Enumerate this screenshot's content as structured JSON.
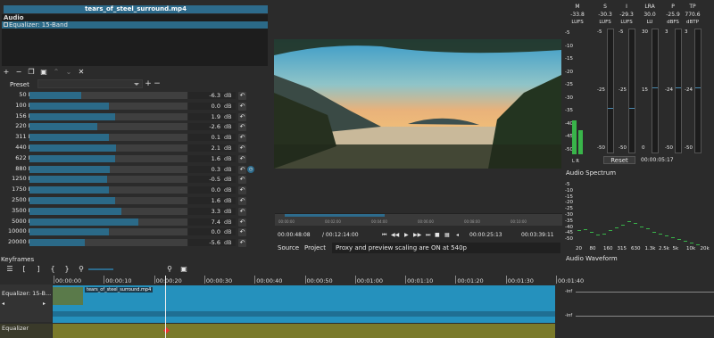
{
  "filter_panel": {
    "title": "tears_of_steel_surround.mp4",
    "group": "Audio",
    "item": "Equalizer: 15-Band",
    "preset_label": "Preset"
  },
  "bands": [
    {
      "label": "50 Hz",
      "value": "-6.3",
      "frac": 0.33
    },
    {
      "label": "100 Hz",
      "value": "0.0",
      "frac": 0.5
    },
    {
      "label": "156 Hz",
      "value": "1.9",
      "frac": 0.54
    },
    {
      "label": "220 Hz",
      "value": "-2.6",
      "frac": 0.43
    },
    {
      "label": "311 Hz",
      "value": "0.1",
      "frac": 0.5
    },
    {
      "label": "440 Hz",
      "value": "2.1",
      "frac": 0.55
    },
    {
      "label": "622 Hz",
      "value": "1.6",
      "frac": 0.54
    },
    {
      "label": "880 Hz",
      "value": "0.3",
      "frac": 0.51
    },
    {
      "label": "1250 Hz",
      "value": "-0.5",
      "frac": 0.49
    },
    {
      "label": "1750 Hz",
      "value": "0.0",
      "frac": 0.5
    },
    {
      "label": "2500 Hz",
      "value": "1.6",
      "frac": 0.54
    },
    {
      "label": "3500 Hz",
      "value": "3.3",
      "frac": 0.58
    },
    {
      "label": "5000 Hz",
      "value": "7.4",
      "frac": 0.69
    },
    {
      "label": "10000 Hz",
      "value": "0.0",
      "frac": 0.5
    },
    {
      "label": "20000 Hz",
      "value": "-5.6",
      "frac": 0.35
    }
  ],
  "unit": "dB",
  "player": {
    "ruler": [
      "00:00:00",
      "00:02:00",
      "00:04:00",
      "00:06:00",
      "00:08:00",
      "00:10:00"
    ],
    "position": "00:00:48:08",
    "duration": "/ 00:12:14:00",
    "in_point": "00:00:25:13",
    "out_point": "00:03:39:11",
    "tab_source": "Source",
    "tab_project": "Project",
    "proxy_msg": "Proxy and preview scaling are ON at 540p"
  },
  "meters": {
    "headers": [
      "M",
      "S",
      "I",
      "LRA",
      "P",
      "TP"
    ],
    "values": [
      "-33.8",
      "-30.3",
      "-29.3",
      "30.0",
      "-25.9",
      "770.6"
    ],
    "units": [
      "LUFS",
      "LUFS",
      "LUFS",
      "LU",
      "dBFS",
      "dBTP"
    ],
    "peak_labels": [
      "-25",
      "-25",
      "-25",
      "15",
      "-24",
      "-24"
    ],
    "bottom_labels": [
      "-50",
      "-50",
      "-50",
      "0",
      "-50",
      "-50"
    ],
    "top_labels": [
      "-5",
      "-5",
      "-5",
      "30",
      "3",
      "3"
    ],
    "reset": "Reset",
    "time": "00:00:05:17",
    "lr": "L R",
    "scale": [
      "-5",
      "-10",
      "-15",
      "-20",
      "-25",
      "-30",
      "-35",
      "-40",
      "-45",
      "-50"
    ]
  },
  "spectrum": {
    "title": "Audio Spectrum",
    "x_labels": [
      "20",
      "80",
      "160",
      "315",
      "630",
      "1.3k",
      "2.5k",
      "5k",
      "10k",
      "20k"
    ],
    "y_labels": [
      "-5",
      "-10",
      "-15",
      "-20",
      "-25",
      "-30",
      "-35",
      "-40",
      "-45",
      "-50"
    ]
  },
  "waveform": {
    "title": "Audio Waveform",
    "scale": [
      "-inf",
      "-inf"
    ]
  },
  "timeline": {
    "keyframes": "Keyframes",
    "times": [
      "00:00:00",
      "00:00:10",
      "00:00:20",
      "00:00:30",
      "00:00:40",
      "00:00:50",
      "00:01:00",
      "00:01:10",
      "00:01:20",
      "00:01:30",
      "00:01:40"
    ],
    "track_name": "Equalizer: 15-B...",
    "clip_name": "tears_of_steel_surround.mp4",
    "filter_track": "Equalizer"
  }
}
